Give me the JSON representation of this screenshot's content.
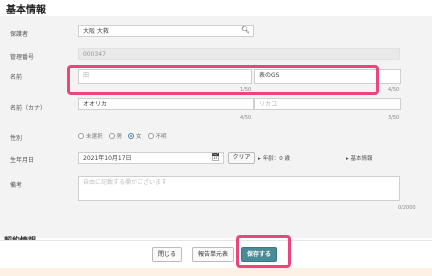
{
  "section_title": "基本情報",
  "sub_section_title": "契約情報",
  "labels": {
    "insurer": "保護者",
    "admin_no": "管理番号",
    "name": "名前",
    "kana": "名前（カナ）",
    "gender": "性別",
    "birthday": "生年月日",
    "notes": "備考"
  },
  "fields": {
    "insurer_value": "大阪 大救",
    "admin_no_value": "000347",
    "last_name_value": "田",
    "first_name_value": "表のGS",
    "last_kana_value": "オオリカ",
    "first_kana_value": "リカコ",
    "birthday_value": "2021年10月17日",
    "notes_placeholder": "自由に記載する欄がございます"
  },
  "counters": {
    "last_name": "1/50",
    "first_name": "4/50",
    "last_kana": "4/50",
    "first_kana": "3/50",
    "notes": "0/2000"
  },
  "gender_options": [
    {
      "label": "未選択",
      "checked": false
    },
    {
      "label": "男",
      "checked": false
    },
    {
      "label": "女",
      "checked": true
    },
    {
      "label": "不明",
      "checked": false
    }
  ],
  "buttons": {
    "clear": "クリア",
    "close": "閉じる",
    "detail": "報告単元表",
    "save": "保存する"
  },
  "age_text": "年齢：0 歳",
  "link_text": "基本情報",
  "colors": {
    "highlight": "#e8467c",
    "primary_button": "#4a8b98"
  }
}
